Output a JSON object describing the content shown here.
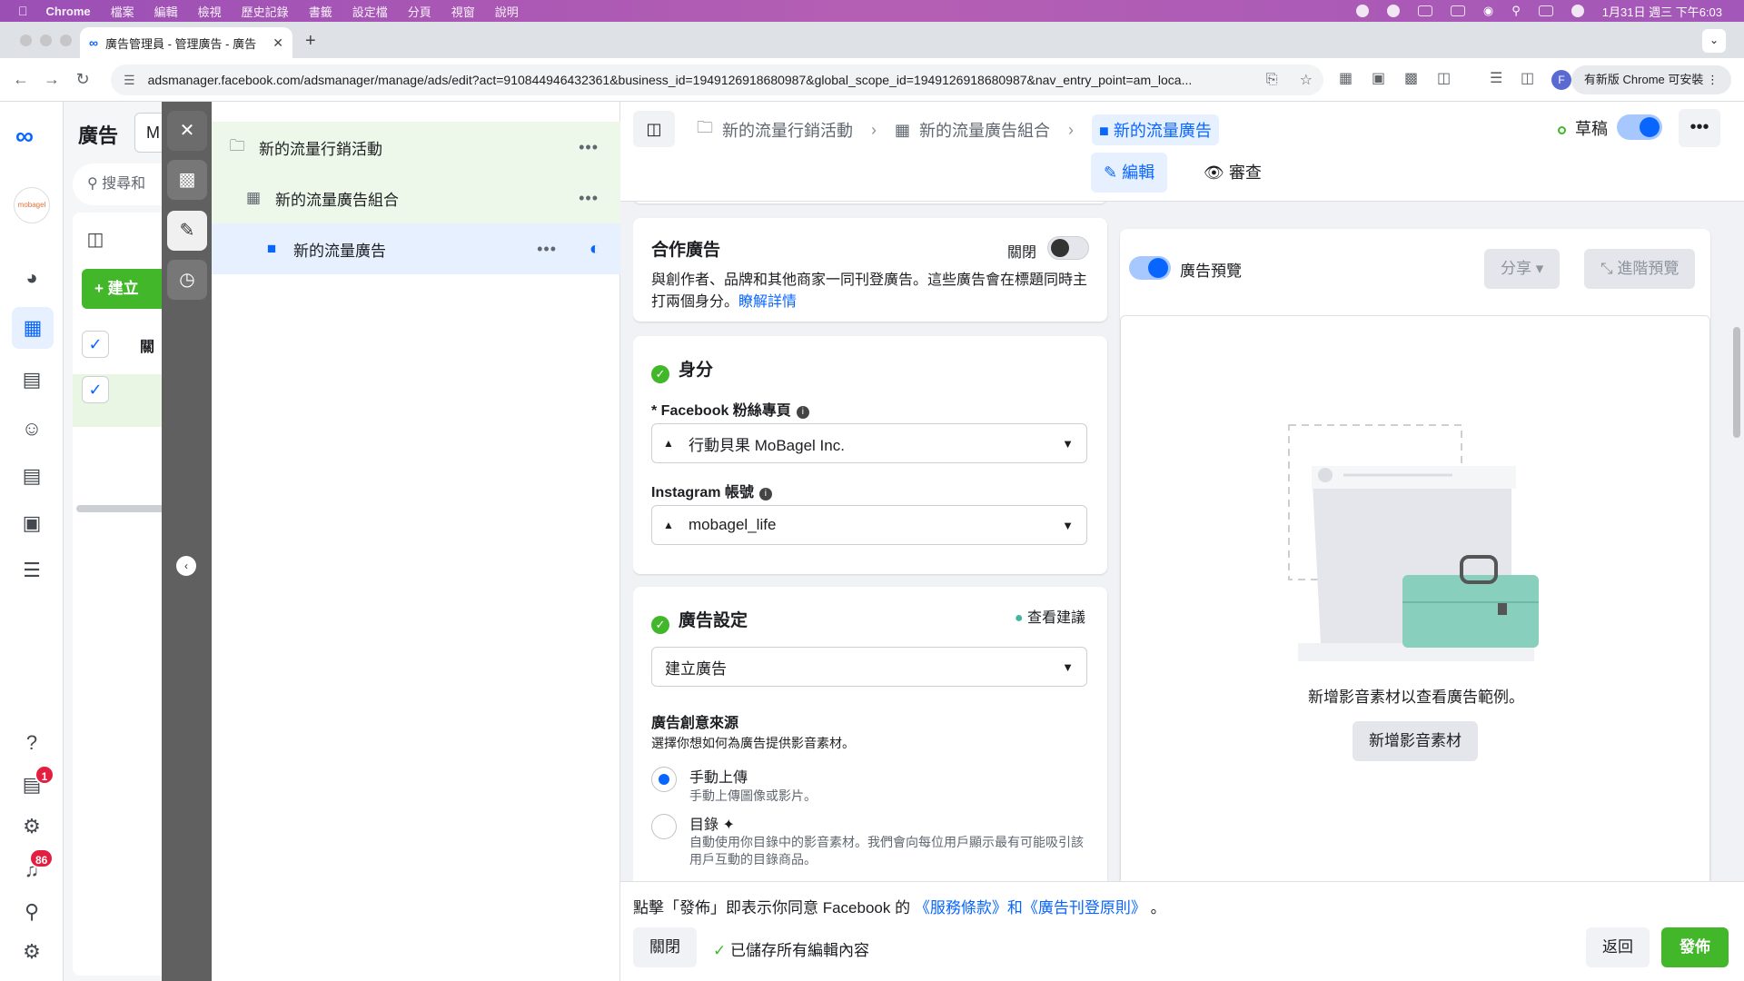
{
  "menubar": {
    "app": "Chrome",
    "items": [
      "檔案",
      "編輯",
      "檢視",
      "歷史記錄",
      "書籤",
      "設定檔",
      "分頁",
      "視窗",
      "說明"
    ],
    "datetime": "1月31日 週三 下午6:03"
  },
  "browser": {
    "tab_title": "廣告管理員 - 管理廣告 - 廣告",
    "url": "adsmanager.facebook.com/adsmanager/manage/ads/edit?act=910844946432361&business_id=1949126918680987&global_scope_id=1949126918680987&nav_entry_point=am_loca...",
    "update_chip": "有新版 Chrome 可安裝",
    "profile_initial": "F"
  },
  "metanav": {
    "account_logo_text": "mobagel",
    "notifications_badge": "1",
    "alerts_badge": "86"
  },
  "background_table": {
    "title": "廣告",
    "account_initial": "M",
    "search_placeholder": "搜尋和",
    "create_label": "建立",
    "col_header": "關"
  },
  "tree": {
    "campaign": "新的流量行銷活動",
    "adset": "新的流量廣告組合",
    "ad": "新的流量廣告"
  },
  "header": {
    "breadcrumb_campaign": "新的流量行銷活動",
    "breadcrumb_adset": "新的流量廣告組合",
    "breadcrumb_ad": "新的流量廣告",
    "status": "草稿",
    "tab_edit": "編輯",
    "tab_review": "審查"
  },
  "partnership": {
    "title": "合作廣告",
    "toggle_label": "關閉",
    "desc": "與創作者、品牌和其他商家一同刊登廣告。這些廣告會在標題同時主打兩個身分。",
    "learn_more": "瞭解詳情"
  },
  "identity": {
    "title": "身分",
    "fb_label": "* Facebook 粉絲專頁",
    "fb_value": "行動貝果 MoBagel Inc.",
    "ig_label": "Instagram 帳號",
    "ig_value": "mobagel_life"
  },
  "ad_setup": {
    "title": "廣告設定",
    "suggest": "查看建議",
    "format_value": "建立廣告",
    "source_title": "廣告創意來源",
    "source_desc": "選擇你想如何為廣告提供影音素材。",
    "opt1_title": "手動上傳",
    "opt1_desc": "手動上傳圖像或影片。",
    "opt2_title": "目錄",
    "opt2_desc": "自動使用你目錄中的影音素材。我們會向每位用戶顯示最有可能吸引該用戶互動的目錄商品。"
  },
  "preview": {
    "toggle_label": "廣告預覽",
    "share": "分享",
    "advanced": "進階預覽",
    "empty_text": "新增影音素材以查看廣告範例。",
    "add_media": "新增影音素材"
  },
  "footer": {
    "terms_prefix": "點擊「發佈」即表示你同意 Facebook 的",
    "terms_link": "《服務條款》和《廣告刊登原則》",
    "terms_suffix": "。",
    "close": "關閉",
    "saved": "已儲存所有編輯內容",
    "back": "返回",
    "publish": "發佈"
  },
  "colors": {
    "accent": "#0866ff",
    "publish_green": "#42b72a",
    "menubar_purple": "#a357b8"
  }
}
